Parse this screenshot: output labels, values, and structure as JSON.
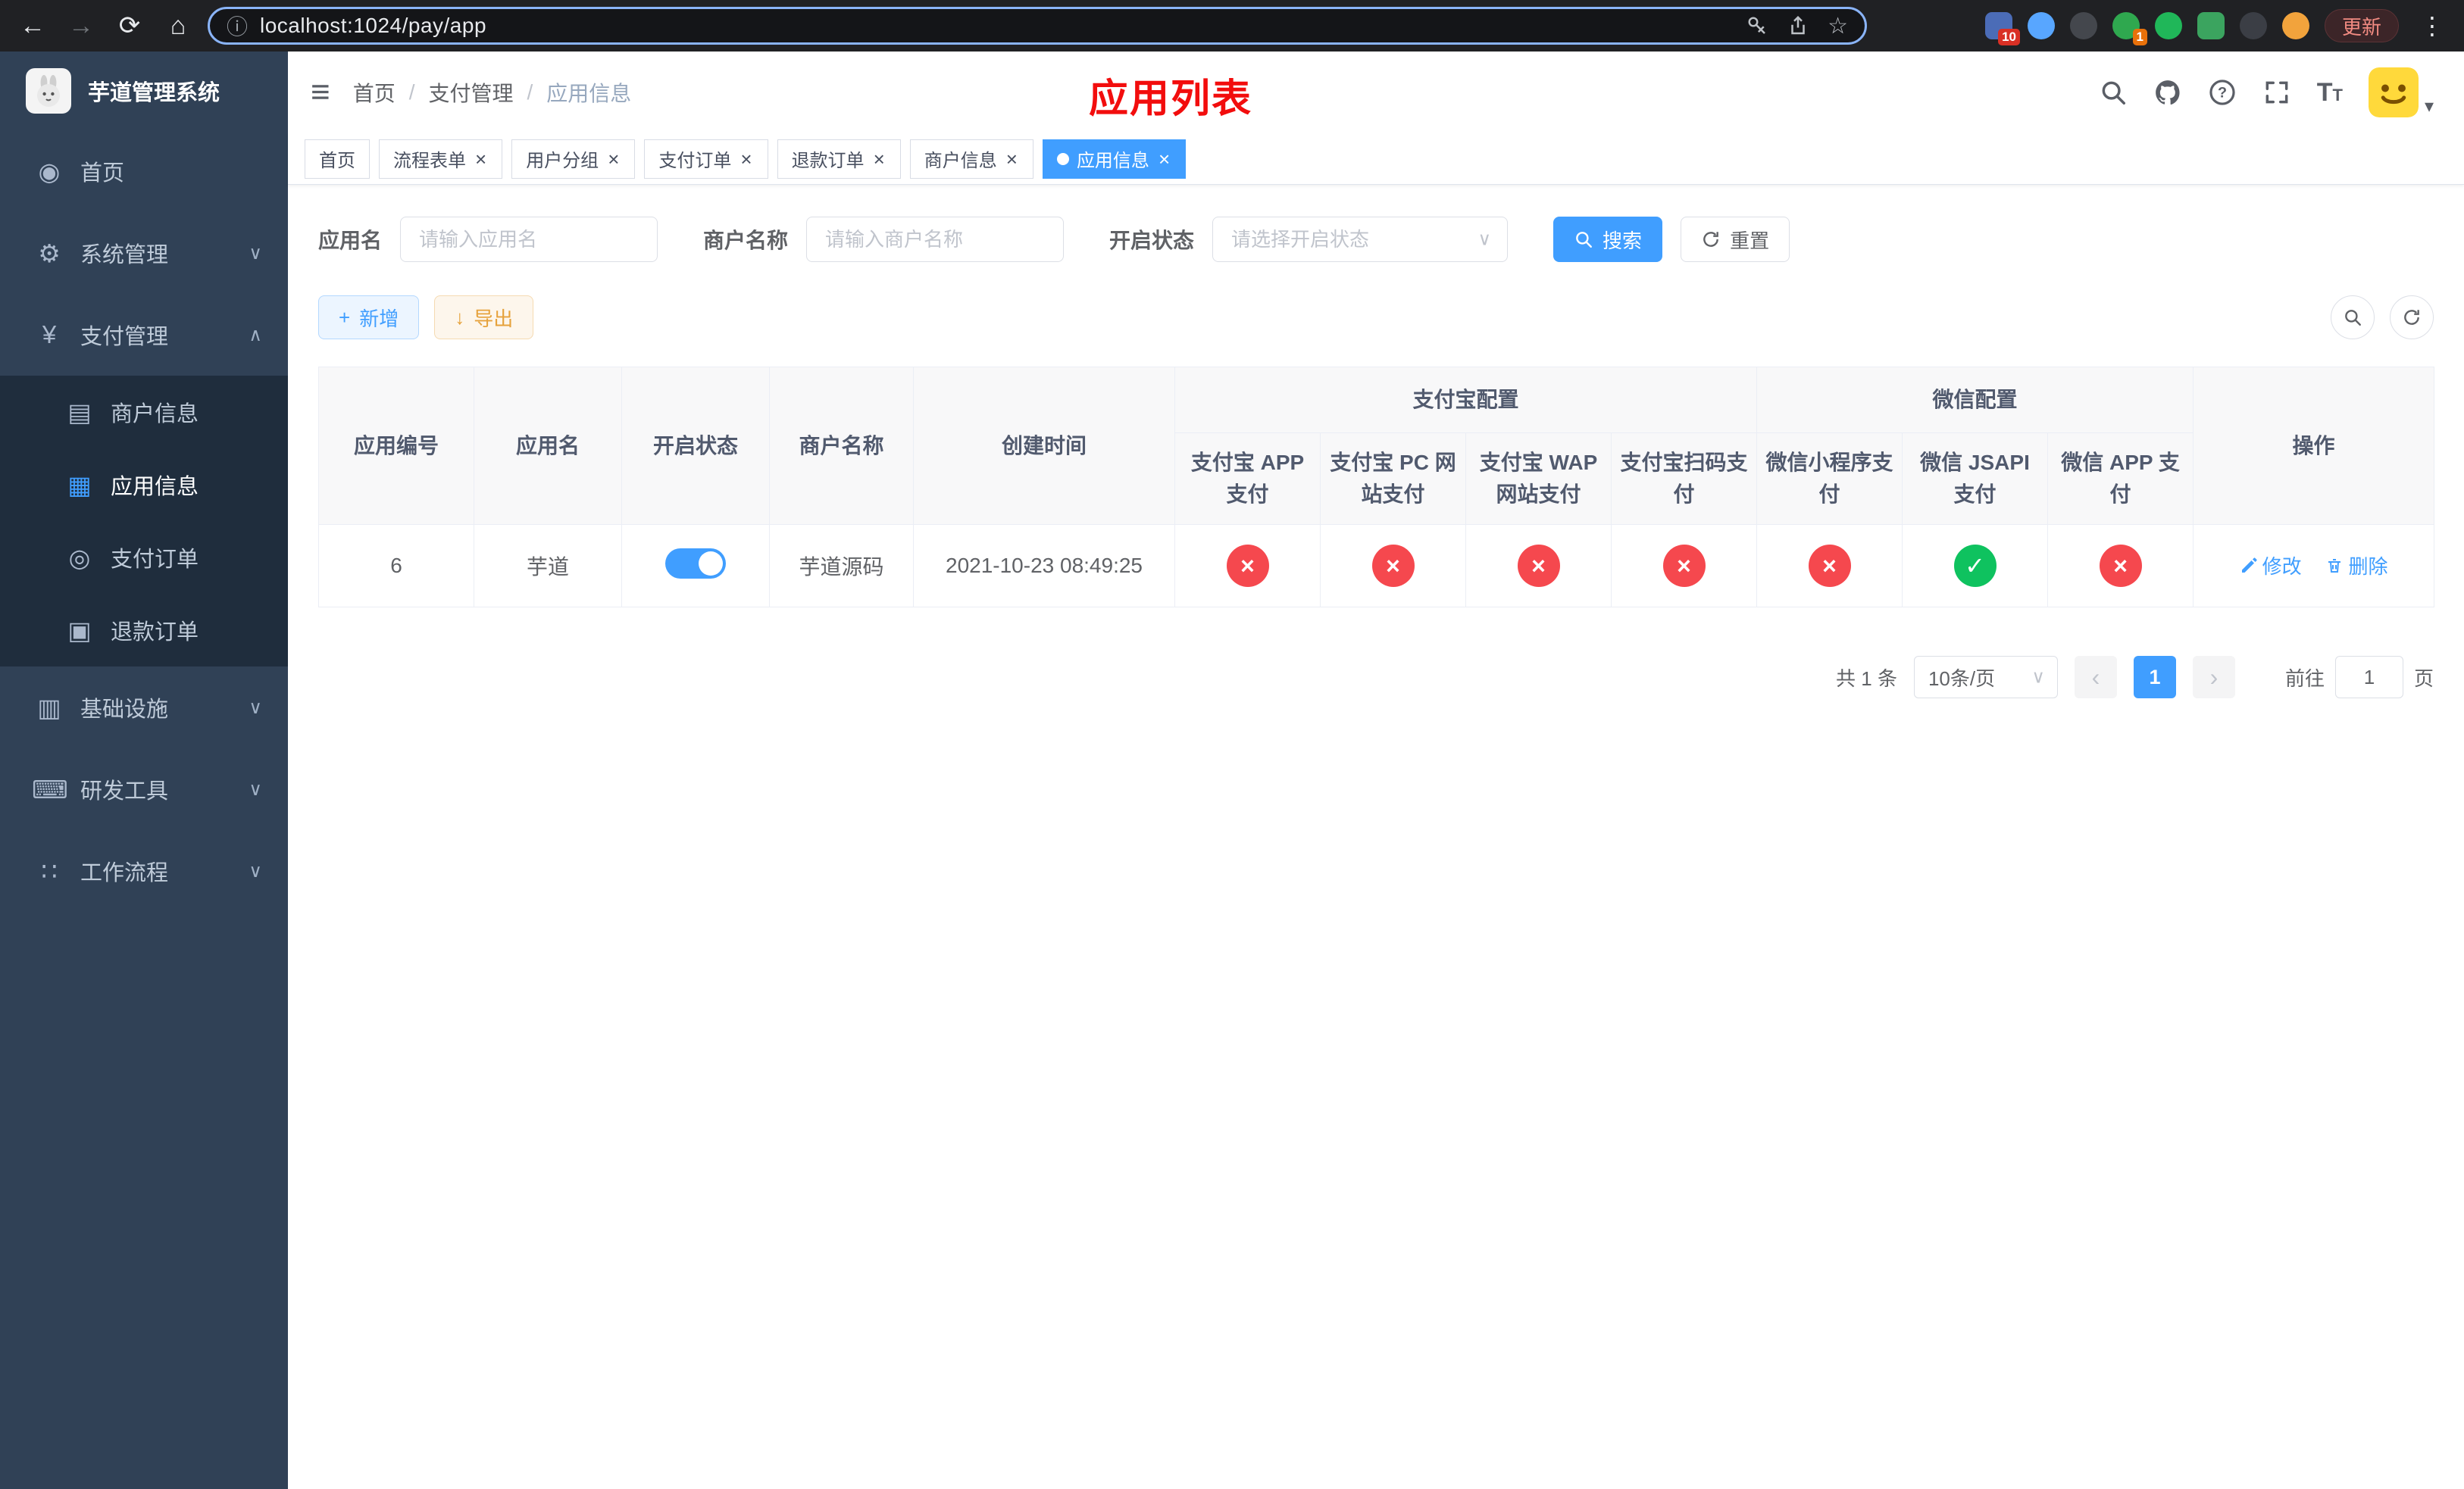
{
  "browser": {
    "url": "localhost:1024/pay/app",
    "update_button": "更新",
    "ext_badge_10": "10",
    "ext_badge_1": "1"
  },
  "colors": {
    "accent": "#409eff",
    "danger": "#f5484e",
    "success": "#0fc25f",
    "sidebar_bg": "#304156",
    "submenu_bg": "#1f2d3d",
    "annotation_red": "#f20d0d"
  },
  "icons": {
    "back": "←",
    "forward": "→",
    "home": "⌂",
    "reload": "⟳",
    "info": "ⓘ",
    "star": "☆",
    "menu_dots": "⋮",
    "hamburger": "≡",
    "breadcrumb_sep": "/",
    "dashboard": "◉",
    "gear": "⚙",
    "yen": "¥",
    "merchant": "▤",
    "app": "▦",
    "order": "◎",
    "refund": "▣",
    "infra": "▥",
    "devtool": "⌨",
    "workflow": "∷",
    "chevron_down": "∨",
    "chevron_up": "∧",
    "caret_down": "▾",
    "close": "×",
    "cross": "×",
    "check": "✓",
    "plus": "+",
    "download": "↓",
    "prev": "‹",
    "next": "›",
    "font_large": "T",
    "font_small": "T"
  },
  "sidebar": {
    "title": "芋道管理系统",
    "items": [
      {
        "label": "首页"
      },
      {
        "label": "系统管理"
      },
      {
        "label": "支付管理"
      },
      {
        "label": "商户信息"
      },
      {
        "label": "应用信息"
      },
      {
        "label": "支付订单"
      },
      {
        "label": "退款订单"
      },
      {
        "label": "基础设施"
      },
      {
        "label": "研发工具"
      },
      {
        "label": "工作流程"
      }
    ]
  },
  "header": {
    "breadcrumb": [
      "首页",
      "支付管理",
      "应用信息"
    ],
    "overlay_title": "应用列表"
  },
  "tabs": [
    {
      "label": "首页"
    },
    {
      "label": "流程表单"
    },
    {
      "label": "用户分组"
    },
    {
      "label": "支付订单"
    },
    {
      "label": "退款订单"
    },
    {
      "label": "商户信息"
    },
    {
      "label": "应用信息"
    }
  ],
  "filters": {
    "app_name_label": "应用名",
    "app_name_placeholder": "请输入应用名",
    "merchant_label": "商户名称",
    "merchant_placeholder": "请输入商户名称",
    "status_label": "开启状态",
    "status_placeholder": "请选择开启状态",
    "search_button": "搜索",
    "reset_button": "重置"
  },
  "toolbar": {
    "add_button": "新增",
    "export_button": "导出"
  },
  "table": {
    "columns_left": [
      "应用编号",
      "应用名",
      "开启状态",
      "商户名称",
      "创建时间"
    ],
    "group_alipay": "支付宝配置",
    "group_wechat": "微信配置",
    "columns_alipay": [
      "支付宝 APP 支付",
      "支付宝 PC 网站支付",
      "支付宝 WAP 网站支付",
      "支付宝扫码支付"
    ],
    "columns_wechat": [
      "微信小程序支付",
      "微信 JSAPI 支付",
      "微信 APP 支付"
    ],
    "column_op": "操作",
    "row": {
      "id": "6",
      "name": "芋道",
      "status_on": true,
      "merchant": "芋道源码",
      "created_at": "2021-10-23 08:49:25",
      "statuses": [
        "off",
        "off",
        "off",
        "off",
        "off",
        "on",
        "off"
      ],
      "edit": "修改",
      "delete": "删除"
    }
  },
  "pagination": {
    "total_text": "共 1 条",
    "page_size": "10条/页",
    "current_page": "1",
    "goto_label": "前往",
    "goto_value": "1",
    "page_suffix": "页"
  }
}
